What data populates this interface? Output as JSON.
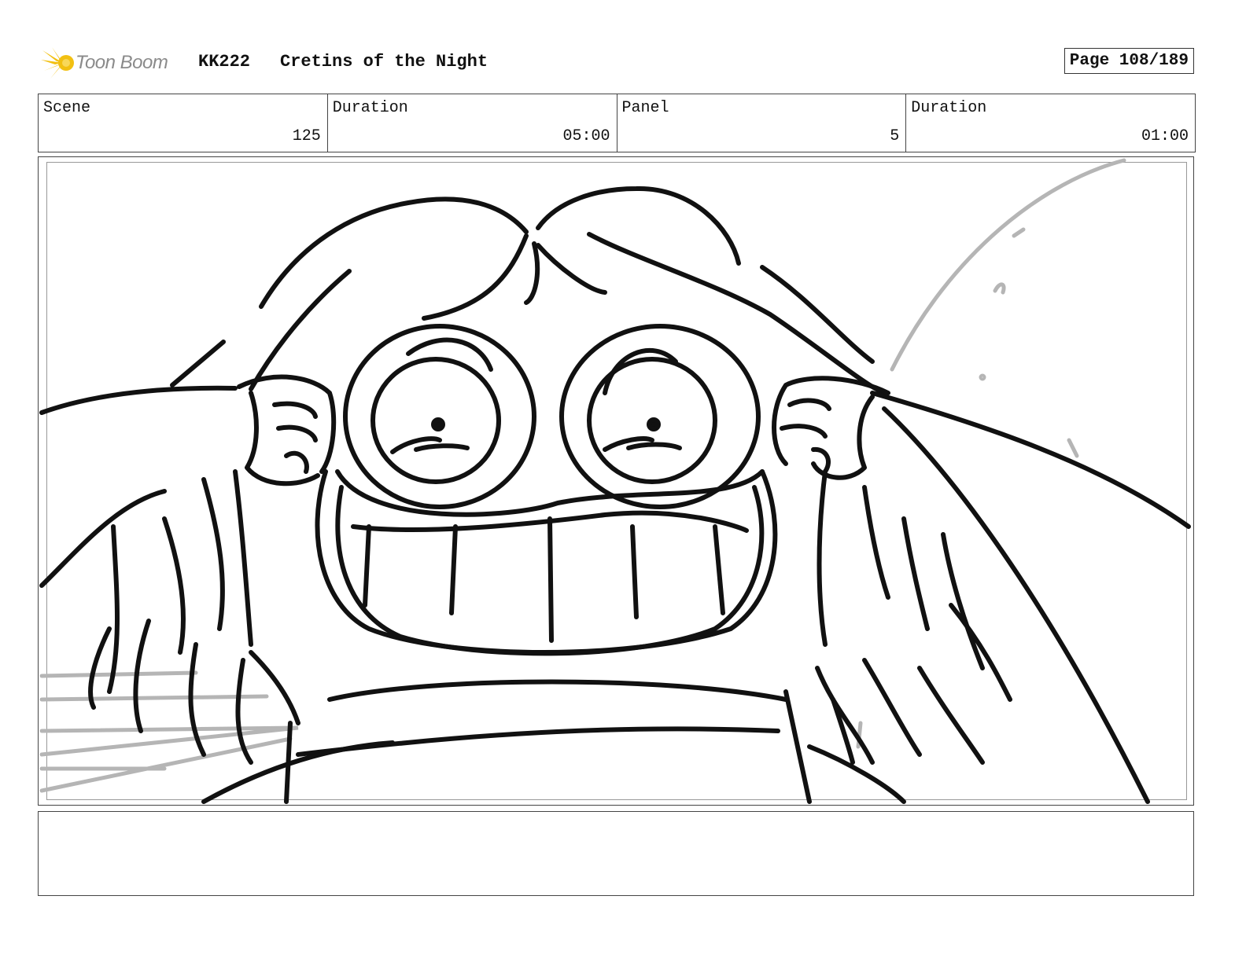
{
  "header": {
    "logo_text": "Toon Boom",
    "project_code": "KK222",
    "project_title": "Cretins of the Night",
    "page_label": "Page 108/189"
  },
  "info": {
    "scene_label": "Scene",
    "scene_value": "125",
    "duration_label": "Duration",
    "duration_value": "05:00",
    "panel_label": "Panel",
    "panel_value": "5",
    "panel_duration_label": "Duration",
    "panel_duration_value": "01:00"
  },
  "colors": {
    "logo_accent": "#f2c012",
    "ink": "#111111",
    "background_sketch": "#b5b5b5"
  },
  "notes": {
    "text": ""
  }
}
